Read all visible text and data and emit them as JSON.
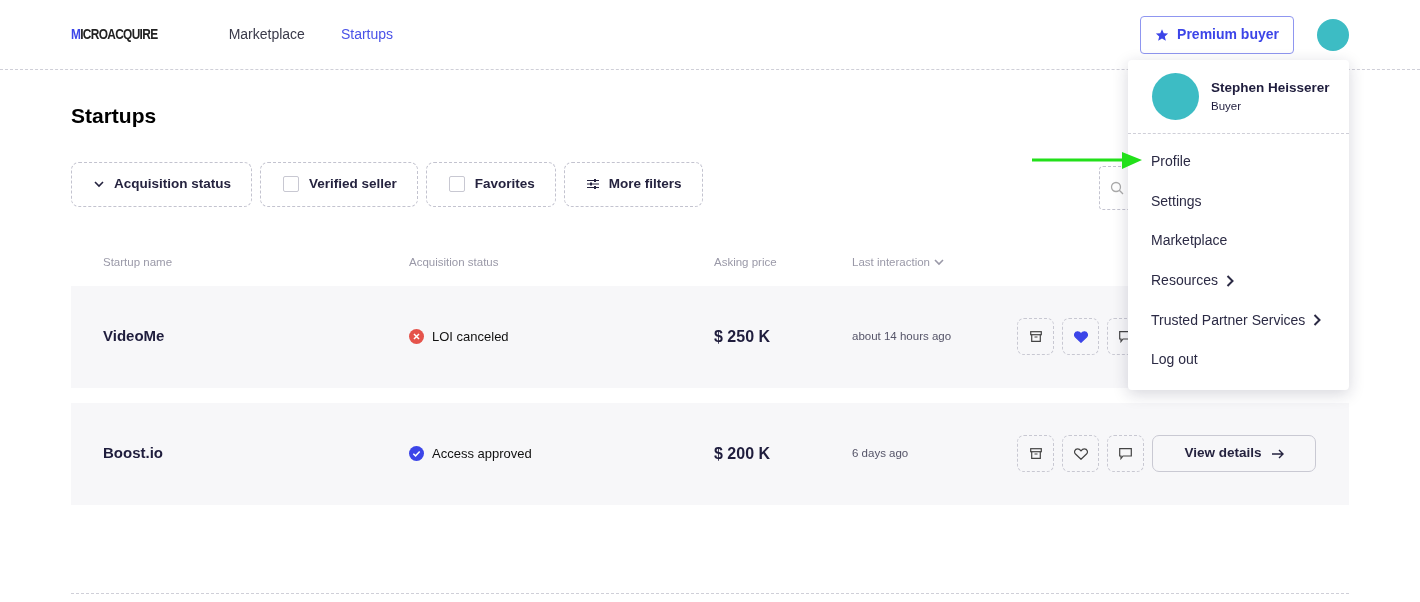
{
  "navbar": {
    "logo": "MICROACQUIRE",
    "links": [
      {
        "label": "Marketplace",
        "selected": false
      },
      {
        "label": "Startups",
        "selected": true
      }
    ],
    "premium_button": "Premium buyer"
  },
  "page_title": "Startups",
  "filters": [
    {
      "kind": "dropdown",
      "label": "Acquisition status"
    },
    {
      "kind": "checkbox",
      "label": "Verified seller",
      "checked": false
    },
    {
      "kind": "checkbox",
      "label": "Favorites",
      "checked": false
    },
    {
      "kind": "more",
      "label": "More filters"
    }
  ],
  "table": {
    "columns": [
      {
        "label": "Startup name",
        "sortable": false
      },
      {
        "label": "Acquisition status",
        "sortable": false
      },
      {
        "label": "Asking price",
        "sortable": false
      },
      {
        "label": "Last interaction",
        "sortable": true
      }
    ],
    "rows": [
      {
        "name": "VideoMe",
        "status": {
          "kind": "canceled",
          "label": "LOI canceled"
        },
        "price": "$ 250 K",
        "last_interaction": "about 14 hours ago",
        "favorite": true
      },
      {
        "name": "Boost.io",
        "status": {
          "kind": "approved",
          "label": "Access approved"
        },
        "price": "$ 200 K",
        "last_interaction": "6 days ago",
        "favorite": false,
        "details_button": "View details"
      }
    ]
  },
  "user_menu": {
    "name": "Stephen Heisserer",
    "role": "Buyer",
    "items": [
      {
        "label": "Profile",
        "has_submenu": false
      },
      {
        "label": "Settings",
        "has_submenu": false
      },
      {
        "label": "Marketplace",
        "has_submenu": false
      },
      {
        "label": "Resources",
        "has_submenu": true
      },
      {
        "label": "Trusted Partner Services",
        "has_submenu": true
      },
      {
        "label": "Log out",
        "has_submenu": false
      }
    ]
  }
}
